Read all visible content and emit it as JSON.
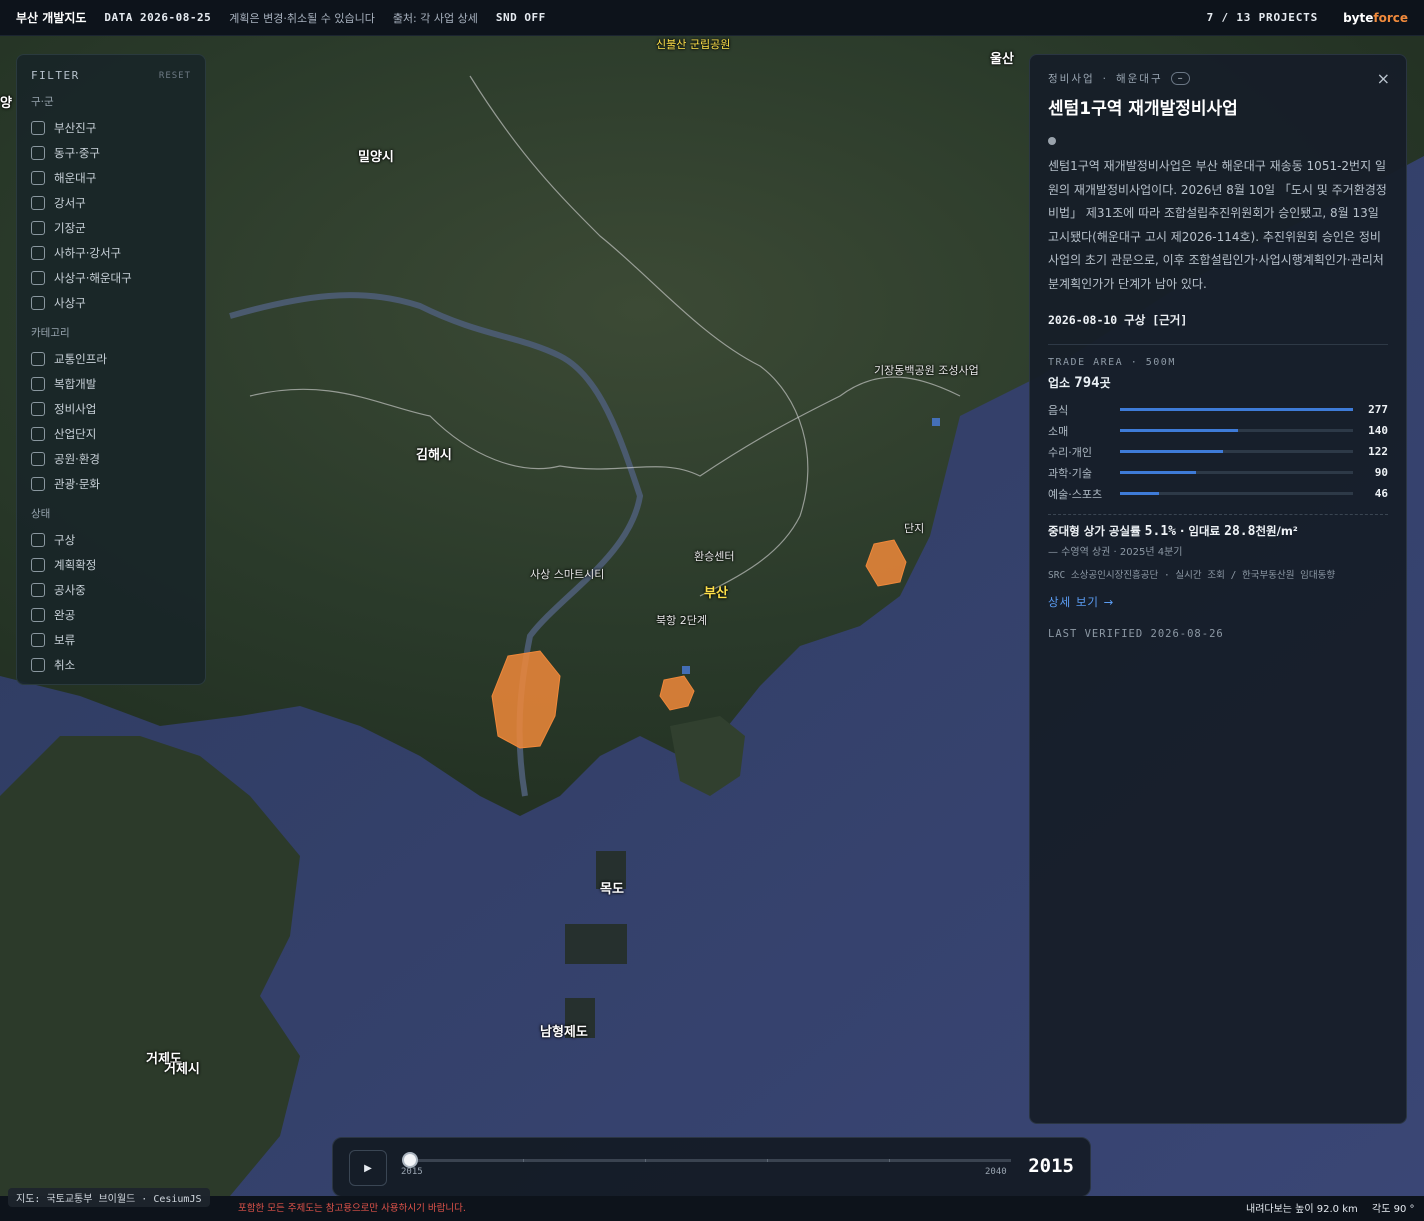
{
  "topbar": {
    "title": "부산 개발지도",
    "data_date": "DATA 2026-08-25",
    "notice": "계획은 변경·취소될 수 있습니다",
    "source": "출처: 각 사업 상세",
    "sound": "SND OFF",
    "projects": "7 / 13 PROJECTS",
    "brand_a": "byte",
    "brand_b": "force"
  },
  "map_labels": {
    "ulsan": "울산",
    "sinbulsan": "신불산 군립공원",
    "miryang": "밀양시",
    "gimhae": "김해시",
    "busan": "부산",
    "sasang": "사상 스마트시티",
    "hwanseung": "환승센터",
    "bukhang": "북항 2단계",
    "gijang": "기장동백공원 조성사업",
    "danji": "단지",
    "mokdo": "목도",
    "namhyeongje": "남형제도",
    "geoje": "거제도",
    "geojesi": "거제시",
    "left_edge": "양"
  },
  "filter": {
    "title": "FILTER",
    "reset": "RESET",
    "sections": [
      {
        "label": "구·군",
        "options": [
          "부산진구",
          "동구·중구",
          "해운대구",
          "강서구",
          "기장군",
          "사하구·강서구",
          "사상구·해운대구",
          "사상구"
        ]
      },
      {
        "label": "카테고리",
        "options": [
          "교통인프라",
          "복합개발",
          "정비사업",
          "산업단지",
          "공원·환경",
          "관광·문화"
        ]
      },
      {
        "label": "상태",
        "options": [
          "구상",
          "계획확정",
          "공사중",
          "완공",
          "보류",
          "취소"
        ]
      }
    ]
  },
  "detail": {
    "category": "정비사업",
    "district": "해운대구",
    "status_pill": "–",
    "close": "×",
    "title": "센텀1구역 재개발정비사업",
    "description": "센텀1구역 재개발정비사업은 부산 해운대구 재송동 1051-2번지 일원의 재개발정비사업이다. 2026년 8월 10일 「도시 및 주거환경정비법」 제31조에 따라 조합설립추진위원회가 승인됐고, 8월 13일 고시됐다(해운대구 고시 제2026-114호). 추진위원회 승인은 정비사업의 초기 관문으로, 이후 조합설립인가·사업시행계획인가·관리처분계획인가가 단계가 남아 있다.",
    "date_status": "2026-08-10 구상 [근거]",
    "trade_area": "TRADE AREA · 500M",
    "biz_prefix": "업소",
    "biz_count": "794",
    "biz_suffix": "곳",
    "bars": [
      {
        "label": "음식",
        "value": 277
      },
      {
        "label": "소매",
        "value": 140
      },
      {
        "label": "수리·개인",
        "value": 122
      },
      {
        "label": "과학·기술",
        "value": 90
      },
      {
        "label": "예술·스포츠",
        "value": 46
      }
    ],
    "bar_max": 277,
    "vacancy_prefix": "중대형 상가 공실률",
    "vacancy_rate": "5.1%",
    "rent_prefix": "· 임대료",
    "rent_value": "28.8",
    "rent_unit": "천원/m²",
    "vacancy_sub": "— 수영역 상권 · 2025년 4분기",
    "src": "SRC 소상공인시장진흥공단 · 실시간 조회 / 한국부동산원 임대동향",
    "more": "상세 보기 →",
    "verified": "LAST VERIFIED 2026-08-26"
  },
  "timeline": {
    "play": "▶",
    "start": "2015",
    "end": "2040",
    "current": "2015",
    "progress": 0
  },
  "bottombar": {
    "credit": "지도: 국토교통부 브이월드 · CesiumJS",
    "warning": "포함한 모든 주제도는 참고용으로만 사용하시기 바랍니다.",
    "height": "내려다보는 높이 92.0 km",
    "angle": "각도 90 °"
  },
  "colors": {
    "accent": "#f08a3c",
    "bar": "#3e7bd8",
    "link": "#5b9cf2",
    "project_fill": "#f0883a"
  }
}
